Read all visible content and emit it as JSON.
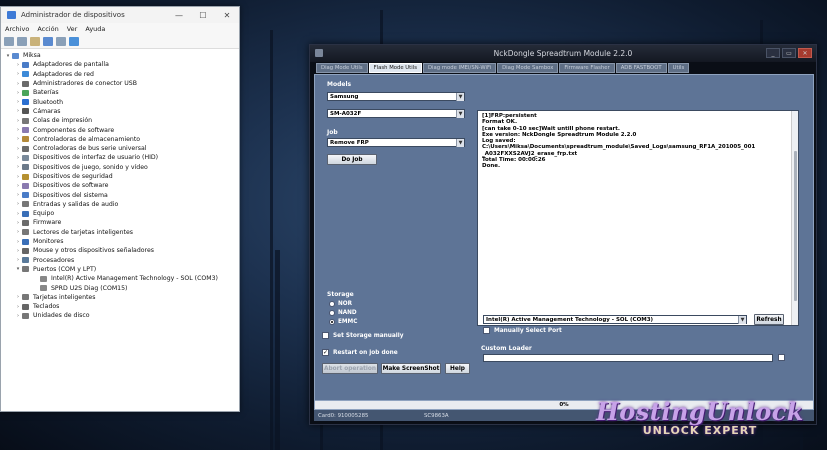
{
  "device_manager": {
    "title": "Administrador de dispositivos",
    "window_buttons": [
      "—",
      "☐",
      "✕"
    ],
    "menu": [
      "Archivo",
      "Acción",
      "Ver",
      "Ayuda"
    ],
    "root": "Miksa",
    "items": [
      {
        "label": "Adaptadores de pantalla",
        "color": "#4a7cc7",
        "level": 1
      },
      {
        "label": "Adaptadores de red",
        "color": "#3d8ad8",
        "level": 1
      },
      {
        "label": "Administradores de conector USB",
        "color": "#6b6b6b",
        "level": 1
      },
      {
        "label": "Baterías",
        "color": "#4aa55a",
        "level": 1
      },
      {
        "label": "Bluetooth",
        "color": "#2b6fd1",
        "level": 1
      },
      {
        "label": "Cámaras",
        "color": "#555",
        "level": 1
      },
      {
        "label": "Colas de impresión",
        "color": "#777",
        "level": 1
      },
      {
        "label": "Componentes de software",
        "color": "#8a7ab0",
        "level": 1
      },
      {
        "label": "Controladoras de almacenamiento",
        "color": "#b48a3a",
        "level": 1
      },
      {
        "label": "Controladoras de bus serie universal",
        "color": "#6b6b6b",
        "level": 1
      },
      {
        "label": "Dispositivos de interfaz de usuario (HID)",
        "color": "#7a8a9a",
        "level": 1
      },
      {
        "label": "Dispositivos de juego, sonido y vídeo",
        "color": "#6c7a8a",
        "level": 1
      },
      {
        "label": "Dispositivos de seguridad",
        "color": "#b59030",
        "level": 1
      },
      {
        "label": "Dispositivos de software",
        "color": "#8a7ab0",
        "level": 1
      },
      {
        "label": "Dispositivos del sistema",
        "color": "#4a7cc7",
        "level": 1
      },
      {
        "label": "Entradas y salidas de audio",
        "color": "#777",
        "level": 1
      },
      {
        "label": "Equipo",
        "color": "#3a6fb8",
        "level": 1
      },
      {
        "label": "Firmware",
        "color": "#6b6b6b",
        "level": 1
      },
      {
        "label": "Lectores de tarjetas inteligentes",
        "color": "#777",
        "level": 1
      },
      {
        "label": "Monitores",
        "color": "#3a6fb8",
        "level": 1
      },
      {
        "label": "Mouse y otros dispositivos señaladores",
        "color": "#666",
        "level": 1
      },
      {
        "label": "Procesadores",
        "color": "#5a7a9a",
        "level": 1
      },
      {
        "label": "Puertos (COM y LPT)",
        "color": "#777",
        "level": 1,
        "expanded": true
      },
      {
        "label": "Intel(R) Active Management Technology - SOL (COM3)",
        "color": "#888",
        "level": 2
      },
      {
        "label": "SPRD U2S Diag (COM15)",
        "color": "#888",
        "level": 2
      },
      {
        "label": "Tarjetas inteligentes",
        "color": "#777",
        "level": 1
      },
      {
        "label": "Teclados",
        "color": "#666",
        "level": 1
      },
      {
        "label": "Unidades de disco",
        "color": "#777",
        "level": 1
      }
    ]
  },
  "nck": {
    "title": "NckDongle Spreadtrum Module 2.2.0",
    "window_buttons": [
      "_",
      "▭",
      "✕"
    ],
    "tabs": [
      {
        "label": "Diag Mode Utils",
        "active": false
      },
      {
        "label": "Flash Mode Utils",
        "active": true
      },
      {
        "label": "Diag mode IMEI/SN-WiFi",
        "active": false
      },
      {
        "label": "Diag Mode Sambox",
        "active": false
      },
      {
        "label": "Firmware Flasher",
        "active": false
      },
      {
        "label": "ADB FASTBOOT",
        "active": false
      },
      {
        "label": "Utils",
        "active": false
      }
    ],
    "models_label": "Models",
    "brand": "Samsung",
    "model": "SM-A032F",
    "job_label": "Job",
    "job": "Remove FRP",
    "do_job": "Do Job",
    "log": [
      "[1]FRP:persistent",
      "Format OK.",
      "[can take 0-10 sec]Wait untill phone restart.",
      "Exe version: NckDongle Spreadtrum Module 2.2.0",
      "Log saved:",
      "C:\\Users\\Miksa\\Documents\\spreadtrum_module\\Saved_Logs\\samsung_RF1A_201005_001",
      "_A032FXXS2AVJ2_erase_frp.txt",
      "Total Time: 00:00:26",
      "Done."
    ],
    "storage_label": "Storage",
    "storage_options": [
      {
        "label": "NOR",
        "selected": false
      },
      {
        "label": "NAND",
        "selected": false
      },
      {
        "label": "EMMC",
        "selected": true
      }
    ],
    "set_storage": "Set Storage manually",
    "restart_label": "Restart on job done",
    "abort": "Abort operation",
    "screenshot": "Make ScreenShot",
    "help": "Help",
    "port_label": "Port",
    "port": "Intel(R) Active Management Technology - SOL (COM3)",
    "refresh": "Refresh",
    "manual_port": "Manually Select Port",
    "custom_loader": "Custom Loader",
    "progress": "0%",
    "status_card": "Card0: 910005285",
    "status_chip": "SC9863A",
    "status_port": "COM3"
  },
  "watermark": {
    "line1": "HostingUnlock",
    "line2": "UNLOCK EXPERT"
  }
}
